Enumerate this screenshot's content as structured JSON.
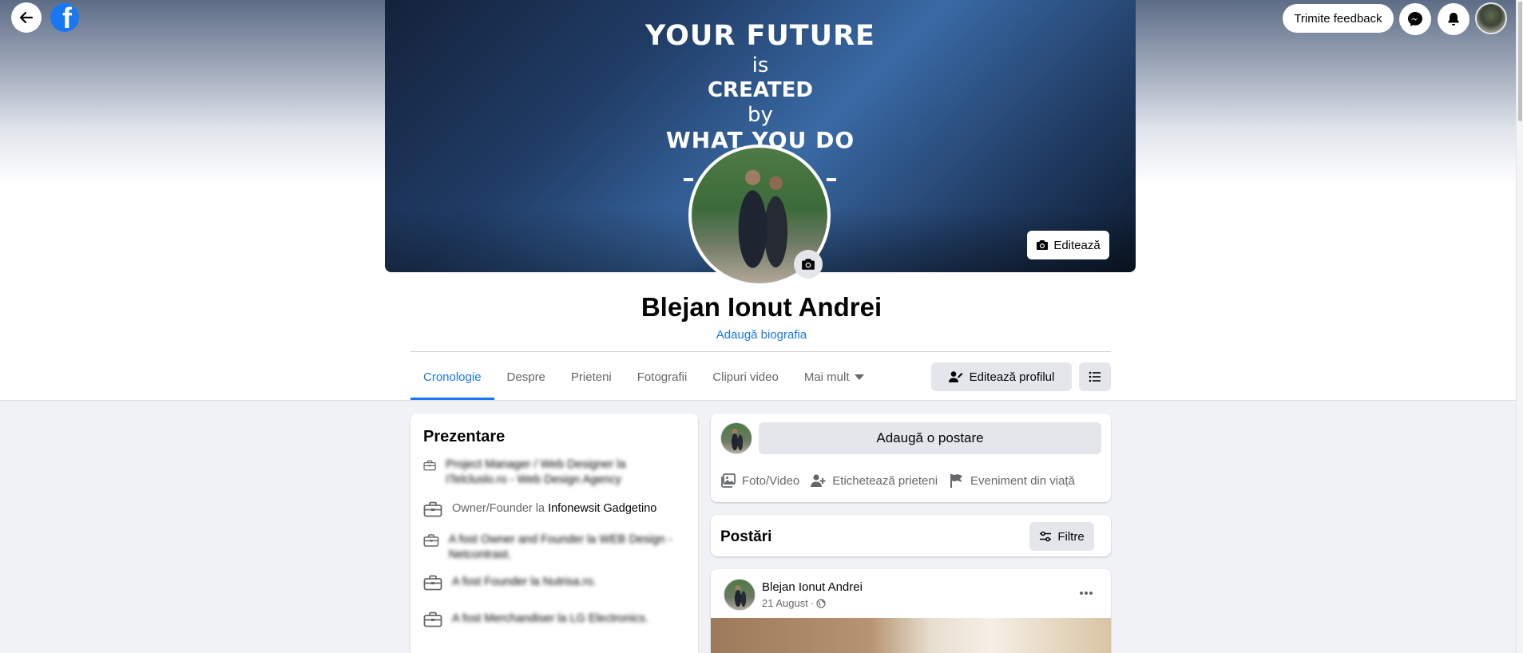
{
  "topbar": {
    "feedback_label": "Trimite feedback",
    "back_icon": "arrow-left-icon",
    "logo": "facebook-logo",
    "messenger_icon": "messenger-icon",
    "notifications_icon": "bell-icon"
  },
  "cover": {
    "line1": "YOUR FUTURE",
    "line2": "is",
    "line3": "CREATED",
    "line4": "by",
    "line5": "WHAT YOU DO",
    "edit_label": "Editează"
  },
  "profile": {
    "name": "Blejan Ionut Andrei",
    "add_bio": "Adaugă biografia"
  },
  "tabs": [
    {
      "label": "Cronologie",
      "active": true
    },
    {
      "label": "Despre"
    },
    {
      "label": "Prieteni"
    },
    {
      "label": "Fotografii"
    },
    {
      "label": "Clipuri video"
    },
    {
      "label": "Mai mult"
    }
  ],
  "actions": {
    "edit_profile": "Editează profilul"
  },
  "intro": {
    "title": "Prezentare",
    "items": [
      {
        "prefix": "Project Manager / Web Designer la ",
        "org": "ITelcluslo.ro - Web Design Agency",
        "blurred": true
      },
      {
        "prefix": "Owner/Founder la ",
        "org": "Infonewsit Gadgetino",
        "blurred": false
      },
      {
        "prefix": "A fost Owner and Founder la ",
        "org": "WEB Design - Netcontrast.",
        "blurred": true
      },
      {
        "prefix": "A fost Founder la ",
        "org": "Nutrisa.ro.",
        "blurred": true
      },
      {
        "prefix": "A fost Merchandiser la ",
        "org": "LG Electronics.",
        "blurred": true
      }
    ]
  },
  "composer": {
    "placeholder": "Adaugă o postare",
    "photo_video": "Foto/Video",
    "tag_friends": "Etichetează prieteni",
    "life_event": "Eveniment din viață"
  },
  "posts": {
    "title": "Postări",
    "filter_label": "Filtre",
    "first": {
      "author": "Blejan Ionut Andrei",
      "date": "21 August",
      "separator": "·"
    }
  }
}
